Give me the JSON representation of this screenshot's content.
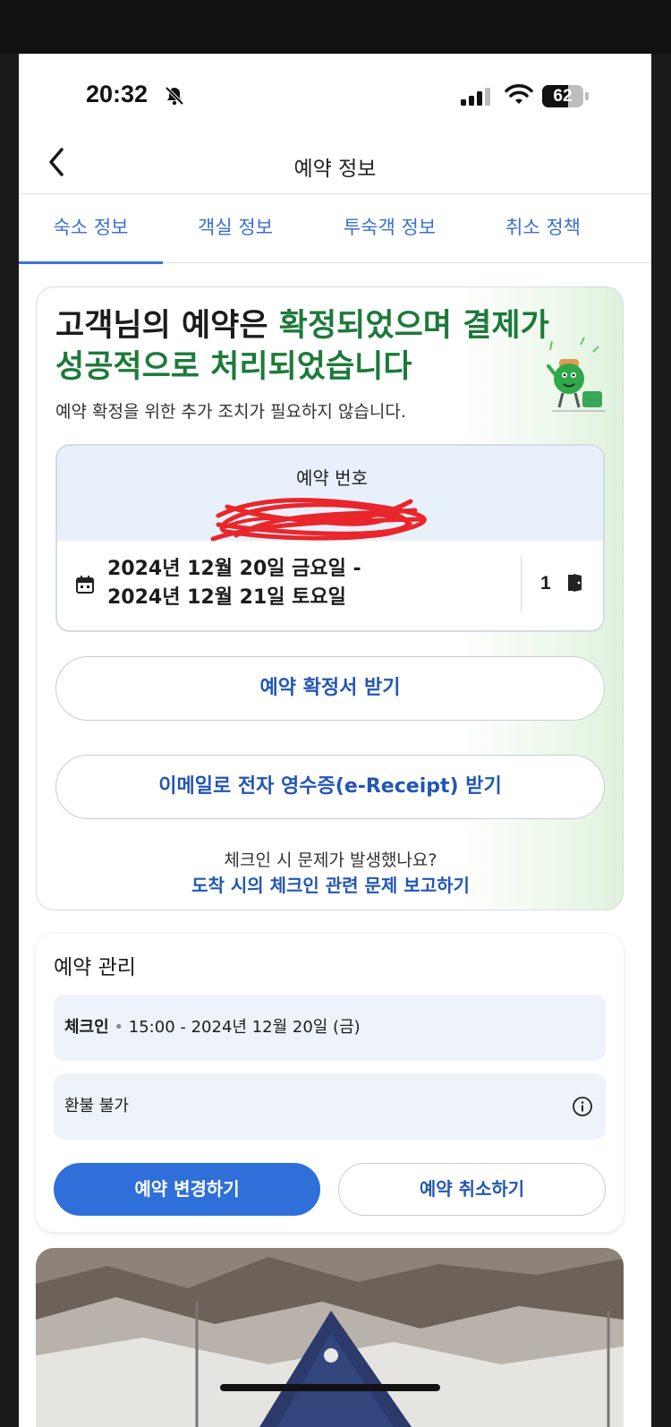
{
  "status_bar": {
    "time": "20:32",
    "battery": "62",
    "battery_level": 0.62
  },
  "header": {
    "title": "예약 정보"
  },
  "tabs": [
    {
      "label": "숙소 정보",
      "active": true
    },
    {
      "label": "객실 정보",
      "active": false
    },
    {
      "label": "투숙객 정보",
      "active": false
    },
    {
      "label": "취소 정책",
      "active": false
    }
  ],
  "confirmation": {
    "headline_part1": "고객님의 예약은 ",
    "headline_green": "확정되었으며 결제가 성공적으로 처리되었습니다",
    "subtext": "예약 확정을 위한 추가 조치가 필요하지 않습니다.",
    "reservation_label": "예약 번호",
    "date_line1": "2024년 12월 20일 금요일 -",
    "date_line2": "2024년 12월 21일 토요일",
    "rooms": "1",
    "btn_confirmation": "예약 확정서 받기",
    "btn_receipt": "이메일로 전자 영수증(e-Receipt) 받기",
    "trouble_question": "체크인 시 문제가 발생했나요?",
    "trouble_link": "도착 시의 체크인 관련 문제 보고하기"
  },
  "manage": {
    "title": "예약 관리",
    "checkin_label": "체크인",
    "checkin_detail": "15:00 - 2024년 12월 20일 (금)",
    "refund": "환불 불가",
    "btn_change": "예약 변경하기",
    "btn_cancel": "예약 취소하기"
  },
  "colors": {
    "accent": "#2f6fd9",
    "link": "#2257b4",
    "green": "#1c7a3a"
  }
}
